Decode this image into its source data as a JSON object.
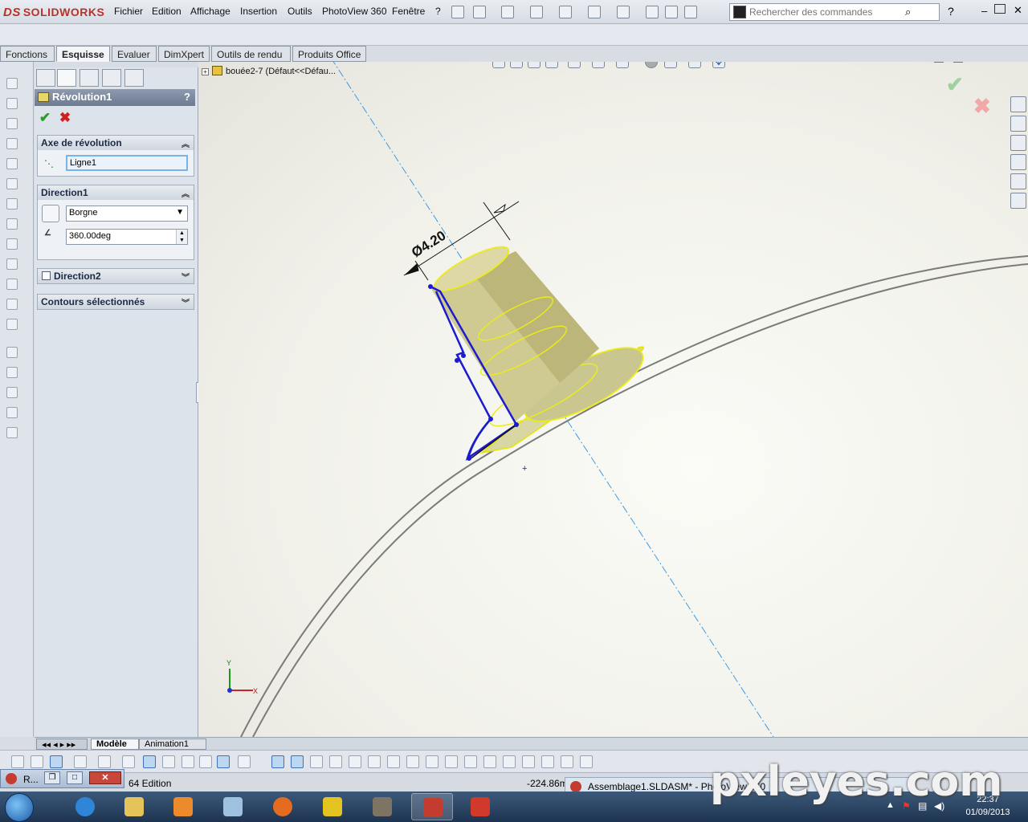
{
  "app": {
    "brand": "SOLIDWORKS",
    "brand_prefix": "DS",
    "accent": "#b8322a"
  },
  "menu": {
    "items": [
      "Fichier",
      "Edition",
      "Affichage",
      "Insertion",
      "Outils",
      "PhotoView 360",
      "Fenêtre",
      "?"
    ]
  },
  "search": {
    "placeholder": "Rechercher des commandes"
  },
  "command_tabs": [
    "Fonctions",
    "Esquisse",
    "Evaluer",
    "DimXpert",
    "Outils de rendu",
    "Produits Office"
  ],
  "active_tab": "Esquisse",
  "property_manager": {
    "title": "Révolution1",
    "help": "?",
    "ok_glyph": "✔",
    "cancel_glyph": "✖",
    "axis_group": {
      "title": "Axe de révolution",
      "value": "Ligne1"
    },
    "direction1": {
      "title": "Direction1",
      "type": "Borgne",
      "angle": "360.00deg"
    },
    "direction2": {
      "title": "Direction2"
    },
    "contours": {
      "title": "Contours sélectionnés"
    }
  },
  "viewport": {
    "tree_root": "bouée2-7  (Défaut<<Défau...",
    "dimension_label": "Ø4.20",
    "axis_labels": {
      "x": "X",
      "y": "Y"
    }
  },
  "bottom_tabs": [
    "Modèle",
    "Animation1"
  ],
  "active_bottom_tab": "Modèle",
  "status": {
    "left": "64 Edition",
    "coord": "-224.86m"
  },
  "mini_window": {
    "title": "R...",
    "close_glyph": "✕"
  },
  "taskbar_window": {
    "title": "Assemblage1.SLDASM* - PhotoView 360"
  },
  "clock": {
    "time": "22:37",
    "date": "01/09/2013"
  },
  "watermark": "pxleyes.com"
}
